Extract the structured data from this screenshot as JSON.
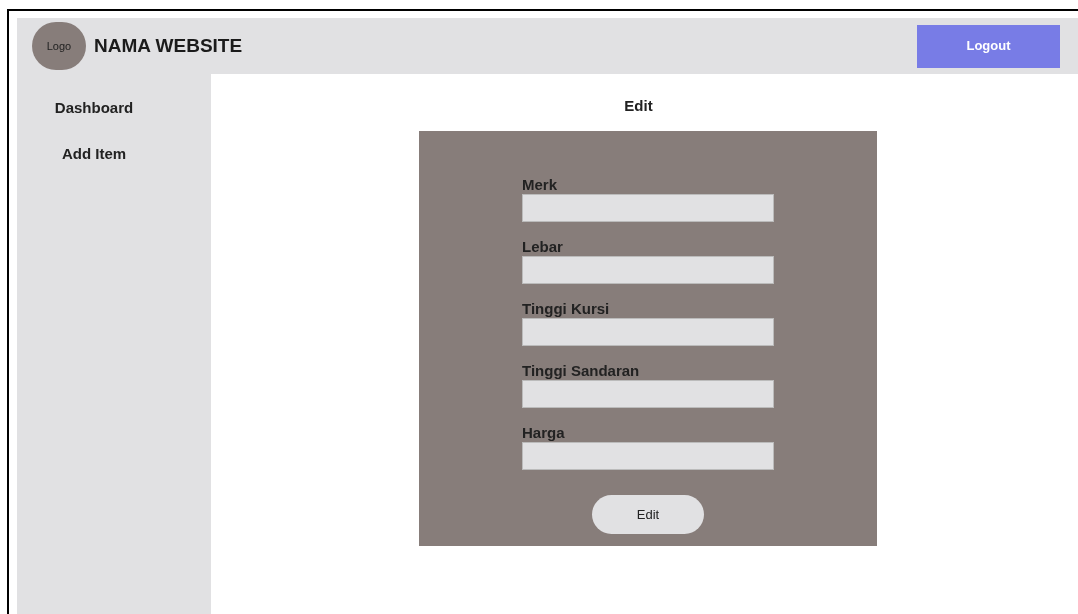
{
  "header": {
    "logo": "Logo",
    "site_name": "NAMA WEBSITE",
    "logout_button": "Logout"
  },
  "sidebar": {
    "items": [
      {
        "label": "Dashboard"
      },
      {
        "label": "Add Item"
      }
    ]
  },
  "page_title": "Edit",
  "form": {
    "fields": [
      {
        "label": "Merk"
      },
      {
        "label": "Lebar"
      },
      {
        "label": "Tinggi Kursi"
      },
      {
        "label": "Tinggi Sandaran"
      },
      {
        "label": "Harga"
      }
    ],
    "submit_button": "Edit"
  }
}
